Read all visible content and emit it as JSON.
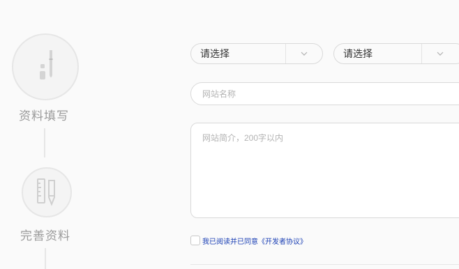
{
  "steps": [
    {
      "label": "资料填写",
      "icon": "pencil-icon"
    },
    {
      "label": "完善资料",
      "icon": "ruler-pen-icon"
    }
  ],
  "form": {
    "select1": {
      "value": "请选择"
    },
    "select2": {
      "value": "请选择"
    },
    "site_name": {
      "placeholder": "网站名称",
      "value": ""
    },
    "site_intro": {
      "placeholder": "网站简介，200字以内",
      "value": ""
    },
    "agreement": {
      "label": "我已阅读并已同意《开发者协议》",
      "checked": false
    }
  },
  "colors": {
    "link": "#1a3fb4",
    "border": "#d9d9d9",
    "muted": "#9a9a9a"
  }
}
